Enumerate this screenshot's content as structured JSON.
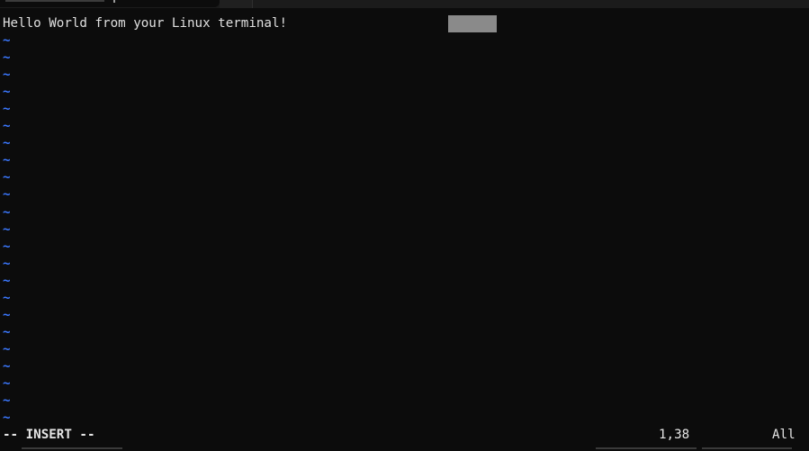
{
  "buffer": {
    "lines": [
      "Hello World from your Linux terminal!"
    ],
    "empty_marker": "~",
    "empty_marker_color": "#3b78ff",
    "cursor_color": "#8a8a8a"
  },
  "statusline": {
    "mode": "-- INSERT --",
    "position": "1,38",
    "scroll": "All"
  },
  "colors": {
    "background": "#0c0c0c",
    "text": "#e0e0e0"
  }
}
